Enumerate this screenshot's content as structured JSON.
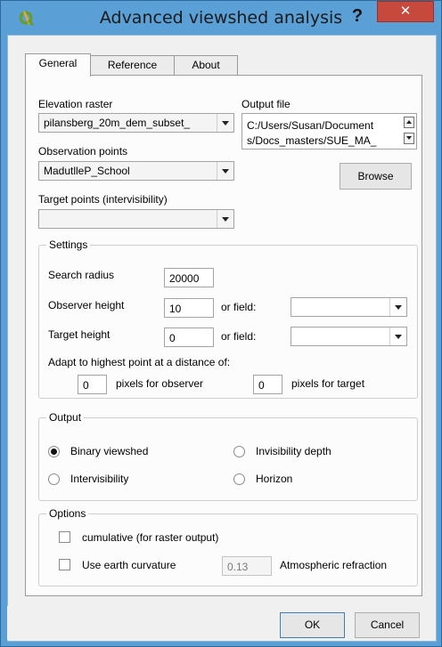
{
  "window": {
    "title": "Advanced viewshed analysis",
    "help_label": "?",
    "close_label": "✕"
  },
  "tabs": [
    "General",
    "Reference",
    "About"
  ],
  "general": {
    "elevation_label": "Elevation raster",
    "elevation_value": "pilansberg_20m_dem_subset_",
    "output_label": "Output file",
    "output_value_line1": "C:/Users/Susan/Document",
    "output_value_line2": "s/Docs_masters/SUE_MA_",
    "observation_label": "Observation points",
    "observation_value": "MadutlleP_School",
    "browse_label": "Browse",
    "target_label": "Target points (intervisibility)",
    "target_value": ""
  },
  "settings": {
    "title": "Settings",
    "search_radius_label": "Search radius",
    "search_radius_value": "20000",
    "observer_height_label": "Observer height",
    "observer_height_value": "10",
    "or_field_label": "or field:",
    "target_height_label": "Target height",
    "target_height_value": "0",
    "adapt_label": "Adapt to highest point at a distance of:",
    "observer_pixels_value": "0",
    "observer_pixels_label": "pixels for observer",
    "target_pixels_value": "0",
    "target_pixels_label": "pixels for target"
  },
  "output": {
    "title": "Output",
    "binary_label": "Binary viewshed",
    "invisibility_label": "Invisibility depth",
    "intervisibility_label": "Intervisibility",
    "horizon_label": "Horizon",
    "selected": "Binary viewshed"
  },
  "options": {
    "title": "Options",
    "cumulative_label": "cumulative (for raster output)",
    "curvature_label": "Use earth curvature",
    "refraction_value": "0.13",
    "refraction_label": "Atmospheric refraction"
  },
  "buttons": {
    "ok": "OK",
    "cancel": "Cancel"
  },
  "colors": {
    "titlebar": "#5aa0d6",
    "close": "#c7483c",
    "app_icon": "#6a9a2a"
  }
}
